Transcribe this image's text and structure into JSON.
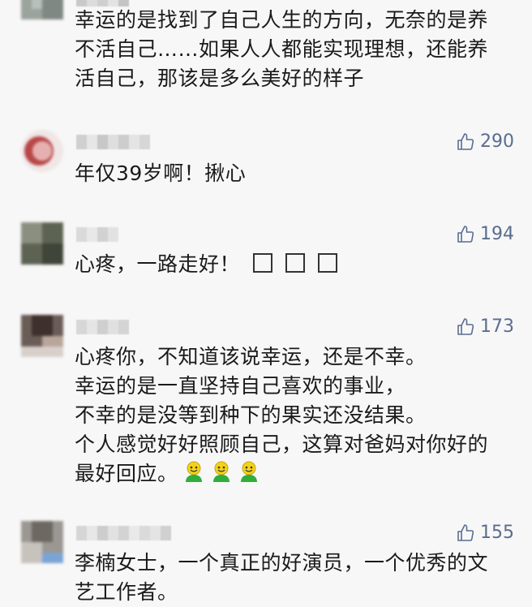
{
  "comments": [
    {
      "text_lines": [
        "幸运的是找到了自己人生的方向，无奈的是养",
        "不活自己……如果人人都能实现理想，还能养",
        "活自己，那该是多么美好的样子"
      ]
    },
    {
      "likes": "290",
      "text_lines": [
        "年仅39岁啊！揪心"
      ]
    },
    {
      "likes": "194",
      "text_lines": [
        "心疼，一路走好！"
      ],
      "trailing_boxes": 3
    },
    {
      "likes": "173",
      "text_lines": [
        "心疼你，不知道该说幸运，还是不幸。",
        "幸运的是一直坚持自己喜欢的事业，",
        "不幸的是没等到种下的果实还没结果。",
        "个人感觉好好照顾自己，这算对爸妈对你好的",
        "最好回应。"
      ],
      "trailing_emoji": [
        "green-smiley-icon",
        "green-smiley-icon",
        "green-smiley-icon"
      ]
    },
    {
      "likes": "155",
      "text_lines": [
        "李楠女士，一个真正的好演员，一个优秀的文",
        "艺工作者。"
      ]
    }
  ],
  "colors": {
    "background": "#f7f7f7",
    "text": "#1a1a1a",
    "like": "#5a6d8f"
  }
}
